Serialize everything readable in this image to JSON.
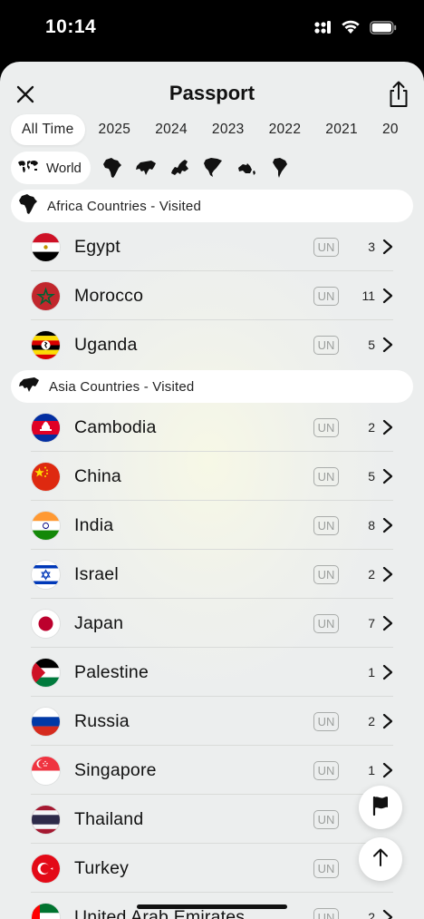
{
  "status": {
    "time": "10:14"
  },
  "header": {
    "title": "Passport",
    "close_icon": "close-icon",
    "share_icon": "share-icon"
  },
  "tabs": [
    {
      "label": "All Time",
      "active": true
    },
    {
      "label": "2025"
    },
    {
      "label": "2024"
    },
    {
      "label": "2023"
    },
    {
      "label": "2022"
    },
    {
      "label": "2021"
    },
    {
      "label": "20"
    }
  ],
  "regions": {
    "world_label": "World",
    "continent_icons": [
      "africa-icon",
      "asia-icon",
      "europe-icon",
      "north-america-icon",
      "oceania-icon",
      "south-america-icon"
    ]
  },
  "sections": [
    {
      "label": "Africa Countries - Visited",
      "countries": [
        {
          "name": "Egypt",
          "un": "UN",
          "count": "3"
        },
        {
          "name": "Morocco",
          "un": "UN",
          "count": "11"
        },
        {
          "name": "Uganda",
          "un": "UN",
          "count": "5"
        }
      ]
    },
    {
      "label": "Asia Countries - Visited",
      "countries": [
        {
          "name": "Cambodia",
          "un": "UN",
          "count": "2"
        },
        {
          "name": "China",
          "un": "UN",
          "count": "5"
        },
        {
          "name": "India",
          "un": "UN",
          "count": "8"
        },
        {
          "name": "Israel",
          "un": "UN",
          "count": "2"
        },
        {
          "name": "Japan",
          "un": "UN",
          "count": "7"
        },
        {
          "name": "Palestine",
          "un": "",
          "count": "1"
        },
        {
          "name": "Russia",
          "un": "UN",
          "count": "2"
        },
        {
          "name": "Singapore",
          "un": "UN",
          "count": "1"
        },
        {
          "name": "Thailand",
          "un": "UN",
          "count": ""
        },
        {
          "name": "Turkey",
          "un": "UN",
          "count": ""
        },
        {
          "name": "United Arab Emirates",
          "un": "UN",
          "count": "2"
        }
      ]
    }
  ],
  "fabs": [
    "flag-icon",
    "arrow-up-icon"
  ]
}
